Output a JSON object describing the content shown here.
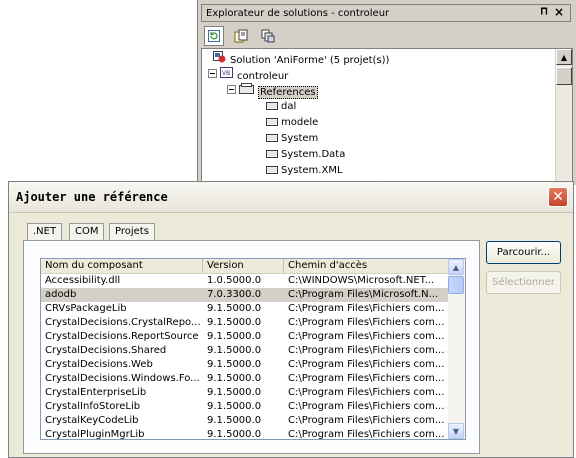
{
  "explorer": {
    "title": "Explorateur de solutions - controleur",
    "pin_glyph": "p",
    "close_glyph": "✖",
    "toolbar": [
      "refresh-icon",
      "properties-icon",
      "show-all-files-icon"
    ],
    "tree": {
      "solution": "Solution 'AniForme' (5 projet(s))",
      "project": "controleur",
      "references": "References",
      "items": [
        "dal",
        "modele",
        "System",
        "System.Data",
        "System.XML"
      ]
    }
  },
  "dialog": {
    "title": "Ajouter une référence",
    "tabs": [
      ".NET",
      "COM",
      "Projets"
    ],
    "active_tab": ".NET",
    "columns": [
      "Nom du composant",
      "Version",
      "Chemin d'accès"
    ],
    "rows": [
      [
        "Accessibility.dll",
        "1.0.5000.0",
        "C:\\WINDOWS\\Microsoft.NET..."
      ],
      [
        "adodb",
        "7.0.3300.0",
        "C:\\Program Files\\Microsoft.N..."
      ],
      [
        "CRVsPackageLib",
        "9.1.5000.0",
        "C:\\Program Files\\Fichiers com..."
      ],
      [
        "CrystalDecisions.CrystalRepo...",
        "9.1.5000.0",
        "C:\\Program Files\\Fichiers com..."
      ],
      [
        "CrystalDecisions.ReportSource",
        "9.1.5000.0",
        "C:\\Program Files\\Fichiers com..."
      ],
      [
        "CrystalDecisions.Shared",
        "9.1.5000.0",
        "C:\\Program Files\\Fichiers com..."
      ],
      [
        "CrystalDecisions.Web",
        "9.1.5000.0",
        "C:\\Program Files\\Fichiers com..."
      ],
      [
        "CrystalDecisions.Windows.Fo...",
        "9.1.5000.0",
        "C:\\Program Files\\Fichiers com..."
      ],
      [
        "CrystalEnterpriseLib",
        "9.1.5000.0",
        "C:\\Program Files\\Fichiers com..."
      ],
      [
        "CrystalInfoStoreLib",
        "9.1.5000.0",
        "C:\\Program Files\\Fichiers com..."
      ],
      [
        "CrystalKeyCodeLib",
        "9.1.5000.0",
        "C:\\Program Files\\Fichiers com..."
      ],
      [
        "CrystalPluginMgrLib",
        "9.1.5000.0",
        "C:\\Program Files\\Fichiers com..."
      ]
    ],
    "selected_row": "adodb",
    "buttons": {
      "browse": "Parcourir...",
      "select": "Sélectionner"
    }
  }
}
